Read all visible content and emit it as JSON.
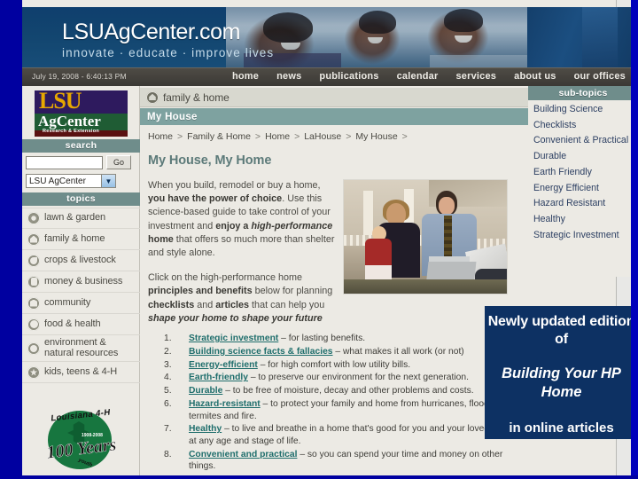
{
  "banner": {
    "title": "LSUAgCenter.com",
    "tagline": "innovate · educate · improve lives"
  },
  "navbar": {
    "datetime": "July 19, 2008 - 6:40:13 PM",
    "links": [
      "home",
      "news",
      "publications",
      "calendar",
      "services",
      "about us",
      "our offices"
    ]
  },
  "logo": {
    "lsu": "LSU",
    "agcenter": "AgCenter",
    "research": "Research & Extension"
  },
  "search": {
    "header": "search",
    "value": "",
    "placeholder": "",
    "go_label": "Go",
    "scope_selected": "LSU AgCenter"
  },
  "topics": {
    "header": "topics",
    "items": [
      {
        "label": "lawn & garden",
        "icon": "flower-icon"
      },
      {
        "label": "family & home",
        "icon": "house-icon"
      },
      {
        "label": "crops & livestock",
        "icon": "leaf-icon"
      },
      {
        "label": "money & business",
        "icon": "dollar-icon"
      },
      {
        "label": "community",
        "icon": "building-icon"
      },
      {
        "label": "food & health",
        "icon": "apple-icon"
      },
      {
        "label": "environment &\nnatural resources",
        "icon": "globe-icon"
      },
      {
        "label": "kids, teens & 4-H",
        "icon": "clover-icon"
      }
    ]
  },
  "fourh_logo": {
    "top_text": "Louisiana 4-H",
    "years": "100 Years",
    "dates": "1908-2008",
    "youth": "youth"
  },
  "section": {
    "family_home_label": "family & home",
    "myhouse_label": "My House"
  },
  "breadcrumb": [
    "Home",
    "Family & Home",
    "Home",
    "LaHouse",
    "My House"
  ],
  "article": {
    "title": "My House, My Home",
    "p1_a": "When you build, remodel or buy a home, ",
    "p1_b": "you have the power of choice",
    "p1_c": ". Use this science-based guide to take control of your investment and ",
    "p1_d": "enjoy a ",
    "p1_e": "high-performance",
    "p1_f": " home",
    "p1_g": " that offers so much more than shelter and style alone.",
    "p2_a": "Click on the high-performance home ",
    "p2_b": "principles and benefits",
    "p2_c": " below for planning ",
    "p2_d": "checklists",
    "p2_e": " and ",
    "p2_f": "articles",
    "p2_g": " that can help you ",
    "p2_h": "shape your home to shape your future"
  },
  "list": [
    {
      "link": "Strategic investment",
      "rest": " – for lasting benefits."
    },
    {
      "link": "Building science facts & fallacies",
      "rest": " – what makes it all work (or not)"
    },
    {
      "link": "Energy-efficient",
      "rest": " – for high comfort with low utility bills."
    },
    {
      "link": "Earth-friendly",
      "rest": " – to preserve our environment for the next generation."
    },
    {
      "link": "Durable",
      "rest": " – to be free of moisture, decay and other problems and costs."
    },
    {
      "link": "Hazard-resistant",
      "rest": " – to protect your family and home from hurricanes, floods, termites and fire."
    },
    {
      "link": "Healthy",
      "rest": " – to live and breathe in a home that's good for you and your loved ones – at any age and stage of life."
    },
    {
      "link": "Convenient and practical",
      "rest": " – so you can spend your time and money on other things."
    }
  ],
  "subtopics": {
    "header": "sub-topics",
    "items": [
      "Building Science",
      "Checklists",
      "Convenient & Practical",
      "Durable",
      "Earth Friendly",
      "Energy Efficient",
      "Hazard Resistant",
      "Healthy",
      "Strategic Investment"
    ]
  },
  "callout": {
    "line1": "Newly updated edition of",
    "line2": "Building Your HP Home",
    "line3": "in online articles"
  },
  "colors": {
    "page_blue": "#0000a0",
    "teal_header": "#7ea2a0",
    "section_teal": "#6f8d8b",
    "link_teal": "#1f6e6c",
    "callout_navy": "#0d3163",
    "page_bg": "#eceae4",
    "navbar_dark": "#44413c"
  }
}
